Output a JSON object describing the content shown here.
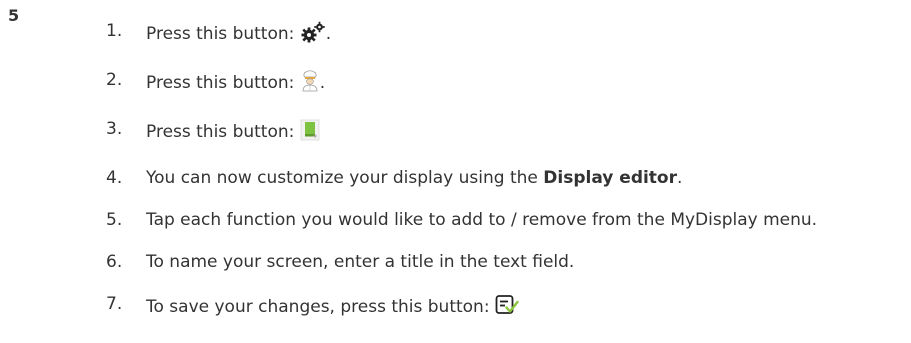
{
  "page_number": "5",
  "steps": [
    {
      "number": "1.",
      "text_before": "Press this button: ",
      "icon": "gears-icon",
      "text_after": "."
    },
    {
      "number": "2.",
      "text_before": "Press this button: ",
      "icon": "chef-icon",
      "text_after": "."
    },
    {
      "number": "3.",
      "text_before": "Press this button: ",
      "icon": "display-editor-icon",
      "text_after": ""
    },
    {
      "number": "4.",
      "text_before": "You can now customize your display using the ",
      "bold": "Display editor",
      "text_after": "."
    },
    {
      "number": "5.",
      "text": "Tap each function you would like to add to / remove from the MyDisplay menu."
    },
    {
      "number": "6.",
      "text": "To name your screen, enter a title in the text field."
    },
    {
      "number": "7.",
      "text_before": "To save your changes, press this button: ",
      "icon": "save-changes-icon",
      "text_after": ""
    }
  ],
  "colors": {
    "text": "#333333",
    "chef_accent": "#e8a53a",
    "editor_green": "#7ec242",
    "save_check": "#8cc63f"
  }
}
